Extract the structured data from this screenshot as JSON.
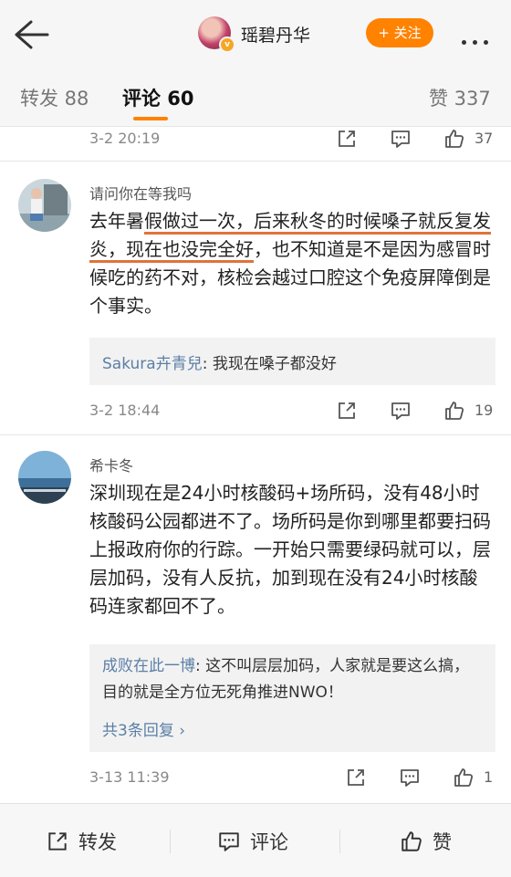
{
  "header": {
    "username": "瑶碧丹华",
    "follow_label": "+ 关注"
  },
  "tabs": [
    {
      "label": "转发 88"
    },
    {
      "label": "评论 60"
    },
    {
      "label": "赞 337"
    }
  ],
  "comments": [
    {
      "time": "3-2 20:19",
      "likes": "37"
    },
    {
      "author": "请问你在等我吗",
      "text_parts": [
        "去年暑",
        "假做过一次，后来秋冬的时候嗓子就",
        "反复发炎，现在也没完全好",
        "，也不知道是不是因为感冒时候吃的药不对，核检会越过口腔这个免疫屏障倒是个事实。"
      ],
      "reply": {
        "name": "Sakura卉青兒",
        "text": ": 我现在嗓子都没好"
      },
      "time": "3-2 18:44",
      "likes": "19"
    },
    {
      "author": "希卡冬",
      "text": "深圳现在是24小时核酸码+场所码，没有48小时核酸码公园都进不了。场所码是你到哪里都要扫码上报政府你的行踪。一开始只需要绿码就可以，层层加码，没有人反抗，加到现在没有24小时核酸码连家都回不了。",
      "reply": {
        "name": "成败在此一博",
        "text": ": 这不叫层层加码，人家就是要这么搞，目的就是全方位无死角推进NWO！",
        "more": "共3条回复 ›"
      },
      "time": "3-13 11:39",
      "likes": "1"
    }
  ],
  "bottom_bar": {
    "repost": "转发",
    "comment": "评论",
    "like": "赞"
  },
  "colors": {
    "accent": "#ff8200",
    "link": "#5b7fa6",
    "highlight_underline": "#e0733a"
  }
}
